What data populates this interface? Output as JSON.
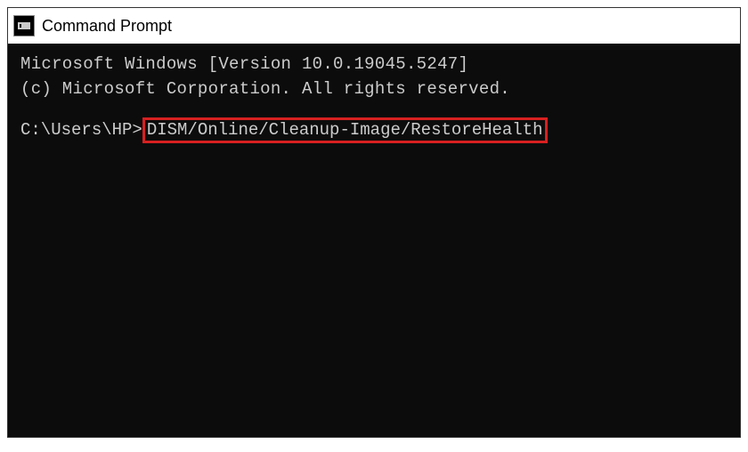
{
  "window": {
    "title": "Command Prompt"
  },
  "terminal": {
    "line1": "Microsoft Windows [Version 10.0.19045.5247]",
    "line2": "(c) Microsoft Corporation. All rights reserved.",
    "prompt_path": "C:\\Users\\HP>",
    "command": "DISM/Online/Cleanup-Image/RestoreHealth"
  },
  "colors": {
    "highlight_border": "#d82020",
    "terminal_bg": "#0c0c0c",
    "terminal_fg": "#cccccc"
  }
}
